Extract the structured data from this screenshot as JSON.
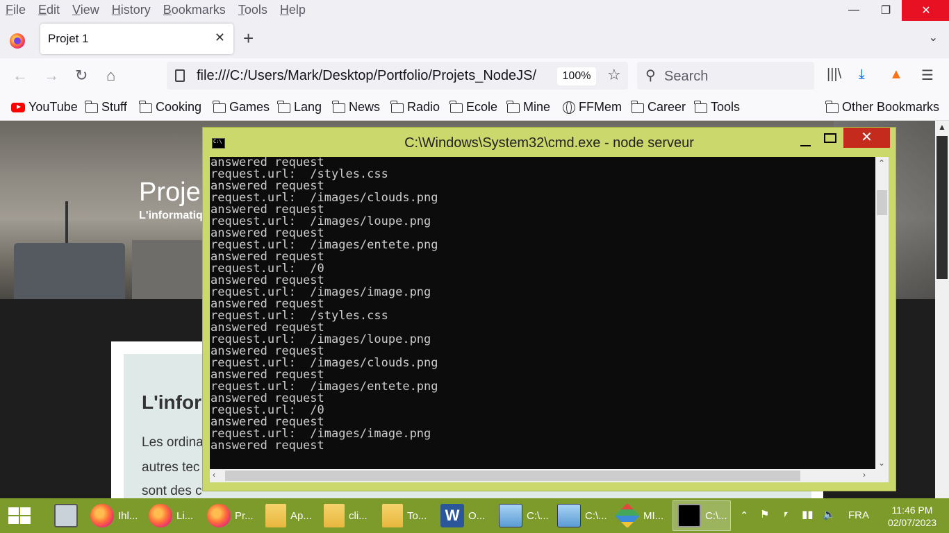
{
  "menubar": {
    "items": [
      "File",
      "Edit",
      "View",
      "History",
      "Bookmarks",
      "Tools",
      "Help"
    ]
  },
  "window_controls": {
    "minimize": "—",
    "restore": "❐",
    "close": "✕"
  },
  "tab": {
    "title": "Projet 1",
    "close": "✕",
    "new_tab": "+"
  },
  "navbar": {
    "url": "file:///C:/Users/Mark/Desktop/Portfolio/Projets_NodeJS/",
    "zoom": "100%",
    "search_placeholder": "Search"
  },
  "bookmarks": {
    "items": [
      "YouTube",
      "Stuff",
      "Cooking",
      "Games",
      "Lang",
      "News",
      "Radio",
      "Ecole",
      "Mine",
      "FFMem",
      "Career",
      "Tools"
    ],
    "other": "Other Bookmarks"
  },
  "page": {
    "title": "Proje",
    "subtitle": "L'informatiq",
    "heading": "L'infor",
    "para1": "Les ordina",
    "para2": "autres tec",
    "para3": "sont des c"
  },
  "cmd": {
    "title": "C:\\Windows\\System32\\cmd.exe - node  serveur",
    "lines": [
      "answered request",
      "request.url:  /styles.css",
      "answered request",
      "request.url:  /images/clouds.png",
      "answered request",
      "request.url:  /images/loupe.png",
      "answered request",
      "request.url:  /images/entete.png",
      "answered request",
      "request.url:  /0",
      "answered request",
      "request.url:  /images/image.png",
      "answered request",
      "request.url:  /styles.css",
      "answered request",
      "request.url:  /images/loupe.png",
      "answered request",
      "request.url:  /images/clouds.png",
      "answered request",
      "request.url:  /images/entete.png",
      "answered request",
      "request.url:  /0",
      "answered request",
      "request.url:  /images/image.png",
      "answered request"
    ]
  },
  "taskbar": {
    "items": [
      {
        "icon": "calculator-icon",
        "label": ""
      },
      {
        "icon": "firefox-icon",
        "label": "Ihl..."
      },
      {
        "icon": "firefox-icon",
        "label": "Li..."
      },
      {
        "icon": "firefox-icon",
        "label": "Pr..."
      },
      {
        "icon": "folder-icon",
        "label": "Ap..."
      },
      {
        "icon": "folder-icon",
        "label": "cli..."
      },
      {
        "icon": "folder-icon",
        "label": "To..."
      },
      {
        "icon": "word-icon",
        "label": "O..."
      },
      {
        "icon": "notepad-icon",
        "label": "C:\\..."
      },
      {
        "icon": "notepad-icon",
        "label": "C:\\..."
      },
      {
        "icon": "git-icon",
        "label": "MI..."
      },
      {
        "icon": "cmd-icon",
        "label": "C:\\..."
      }
    ],
    "language": "FRA",
    "time": "11:46 PM",
    "date": "02/07/2023"
  },
  "colors": {
    "taskbar": "#7d9b2a",
    "cmd_frame": "#cbd86b",
    "close_red": "#c42b1c"
  }
}
